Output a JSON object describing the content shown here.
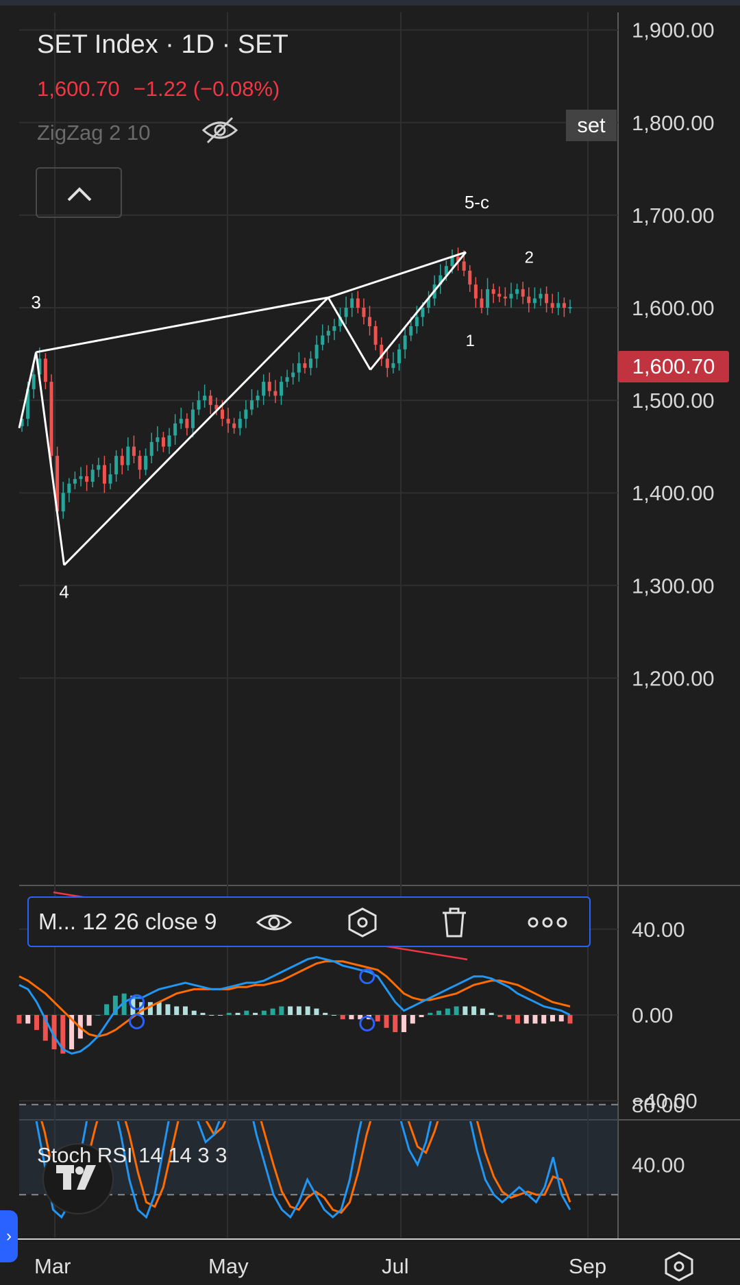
{
  "header": {
    "symbol": "SET Index",
    "sep1": " · ",
    "interval": "1D",
    "sep2": " · ",
    "exchange": "SET",
    "last": "1,600.70",
    "change": "−1.22 (−0.08%)",
    "indicator_label": "ZigZag 2 10",
    "symbol_tag": "set",
    "current_price_tag": "1,600.70"
  },
  "macd_toolbar": {
    "label": "M... 12 26 close 9",
    "icons": [
      "eye-icon",
      "settings-hexagon-icon",
      "trash-icon",
      "more-icon"
    ]
  },
  "stoch": {
    "label": "Stoch RSI 14 14 3 3"
  },
  "colors": {
    "background": "#1e1e1e",
    "up": "#26a69a",
    "down": "#ef5350",
    "zigzag": "#ffffff",
    "macd": "#2196f3",
    "signal": "#ff6d00",
    "stoch_k": "#2196f3",
    "stoch_d": "#ff6d00",
    "price_tag": "#c0333f",
    "accent": "#2962ff"
  },
  "chart_data": [
    {
      "type": "line",
      "subtype": "candlestick",
      "x_ticks": [
        "Mar",
        "May",
        "Jul",
        "Sep"
      ],
      "y_ticks": [
        "1,900.00",
        "1,800.00",
        "1,700.00",
        "1,600.00",
        "1,500.00",
        "1,400.00",
        "1,300.00",
        "1,200.00"
      ],
      "ylim": [
        1100,
        1930
      ],
      "current_price": 1600.7,
      "zigzag": {
        "points": [
          {
            "date": "2023-02-28",
            "price": 1552,
            "label": "3"
          },
          {
            "date": "2023-03-10",
            "price": 1322,
            "label": "4"
          },
          {
            "date": "2023-06-12",
            "price": 1611,
            "label": ""
          },
          {
            "date": "2023-06-27",
            "price": 1533,
            "label": ""
          },
          {
            "date": "2023-07-31",
            "price": 1660,
            "label": "5-c"
          }
        ],
        "extra_labels": [
          {
            "label": "1",
            "date": "2023-08-03",
            "price": 1560
          },
          {
            "label": "2",
            "date": "2023-08-24",
            "price": 1650
          }
        ]
      },
      "candles_close": [
        1480,
        1512,
        1528,
        1545,
        1520,
        1440,
        1380,
        1400,
        1410,
        1415,
        1418,
        1412,
        1425,
        1430,
        1410,
        1420,
        1440,
        1430,
        1450,
        1440,
        1425,
        1440,
        1455,
        1460,
        1450,
        1462,
        1475,
        1480,
        1470,
        1490,
        1500,
        1505,
        1495,
        1490,
        1480,
        1475,
        1470,
        1480,
        1490,
        1500,
        1505,
        1520,
        1510,
        1505,
        1520,
        1525,
        1530,
        1540,
        1535,
        1545,
        1560,
        1570,
        1575,
        1580,
        1590,
        1600,
        1610,
        1600,
        1590,
        1580,
        1560,
        1545,
        1535,
        1540,
        1555,
        1570,
        1580,
        1590,
        1600,
        1610,
        1625,
        1635,
        1645,
        1655,
        1650,
        1640,
        1625,
        1610,
        1600,
        1620,
        1615,
        1612,
        1610,
        1615,
        1620,
        1612,
        1605,
        1610,
        1615,
        1605,
        1600,
        1605,
        1600,
        1600.7
      ],
      "date_range": [
        "2023-02-22",
        "2023-08-28"
      ]
    },
    {
      "type": "line",
      "name": "M... 12 26 close 9",
      "y_ticks": [
        "40.00",
        "0.00",
        "−40.00"
      ],
      "ylim": [
        -48,
        48
      ],
      "macd": [
        14,
        12,
        6,
        -2,
        -10,
        -16,
        -18,
        -17,
        -14,
        -10,
        -4,
        2,
        6,
        8,
        8,
        10,
        12,
        13,
        14,
        15,
        14,
        13,
        12,
        12,
        13,
        14,
        15,
        15,
        16,
        18,
        20,
        22,
        24,
        26,
        27,
        26,
        25,
        23,
        22,
        21,
        20,
        18,
        12,
        6,
        2,
        4,
        6,
        8,
        10,
        12,
        14,
        16,
        18,
        18,
        17,
        15,
        13,
        10,
        8,
        6,
        4,
        3,
        2,
        0
      ],
      "signal": [
        18,
        16,
        13,
        10,
        6,
        2,
        -2,
        -6,
        -9,
        -10,
        -9,
        -7,
        -4,
        -1,
        2,
        4,
        6,
        8,
        10,
        11,
        12,
        12,
        12,
        12,
        12,
        13,
        13,
        14,
        14,
        15,
        16,
        18,
        20,
        22,
        24,
        25,
        25,
        25,
        24,
        23,
        22,
        21,
        18,
        14,
        10,
        8,
        7,
        7,
        8,
        9,
        10,
        12,
        14,
        15,
        16,
        16,
        15,
        14,
        12,
        10,
        8,
        6,
        5,
        4
      ],
      "markers": [
        {
          "date": "2023-03-30",
          "value": 6
        },
        {
          "date": "2023-03-30",
          "value": -3
        },
        {
          "date": "2023-06-20",
          "value": 18
        },
        {
          "date": "2023-06-20",
          "value": -4
        }
      ]
    },
    {
      "type": "line",
      "name": "Stoch RSI 14 14 3 3",
      "y_ticks": [
        "80.00",
        "40.00"
      ],
      "bands": [
        80,
        20
      ],
      "k": [
        95,
        90,
        70,
        40,
        10,
        5,
        15,
        40,
        70,
        90,
        95,
        85,
        60,
        30,
        10,
        5,
        20,
        50,
        80,
        95,
        90,
        70,
        55,
        60,
        75,
        90,
        95,
        85,
        60,
        40,
        20,
        10,
        5,
        15,
        30,
        20,
        10,
        5,
        10,
        30,
        60,
        85,
        95,
        100,
        90,
        70,
        50,
        40,
        55,
        80,
        95,
        100,
        95,
        75,
        50,
        30,
        20,
        15,
        20,
        25,
        20,
        15,
        25,
        45,
        20,
        10
      ],
      "d": [
        98,
        94,
        82,
        62,
        35,
        15,
        10,
        20,
        42,
        65,
        85,
        90,
        80,
        60,
        35,
        15,
        12,
        25,
        50,
        75,
        90,
        85,
        70,
        60,
        65,
        78,
        88,
        92,
        80,
        60,
        40,
        22,
        12,
        10,
        18,
        22,
        18,
        10,
        8,
        15,
        35,
        60,
        80,
        95,
        95,
        85,
        68,
        52,
        48,
        62,
        80,
        95,
        98,
        88,
        70,
        48,
        32,
        22,
        18,
        20,
        22,
        20,
        20,
        32,
        30,
        15
      ]
    }
  ],
  "time_axis_labels": [
    "Mar",
    "May",
    "Jul",
    "Sep"
  ]
}
